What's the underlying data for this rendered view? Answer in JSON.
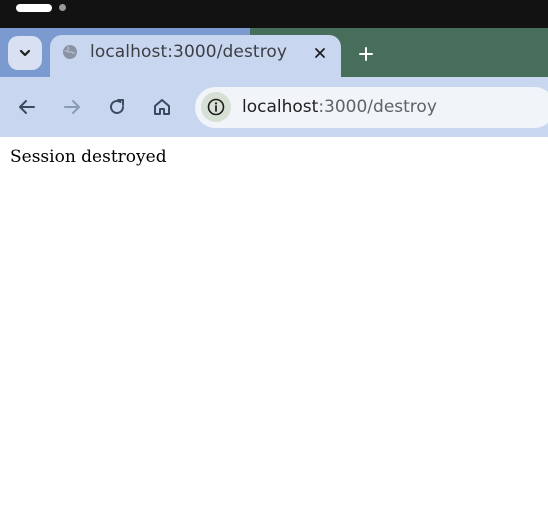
{
  "tab": {
    "title": "localhost:3000/destroy",
    "icons": {
      "dropdown": "chevron-down-icon",
      "favicon": "globe-icon",
      "close": "close-icon",
      "new_tab": "plus-icon"
    }
  },
  "toolbar": {
    "icons": {
      "back": "arrow-left-icon",
      "forward": "arrow-right-icon",
      "reload": "reload-icon",
      "home": "home-icon",
      "site_info": "info-icon"
    }
  },
  "address_bar": {
    "host": "localhost",
    "path": ":3000/destroy"
  },
  "page": {
    "message": "Session destroyed"
  },
  "colors": {
    "system_bar": "#121212",
    "tab_strip": "#7b9ad0",
    "tab_strip_right": "#476e5a",
    "active_tab": "#c9d6f0",
    "omnibox": "#f1f4f8"
  }
}
